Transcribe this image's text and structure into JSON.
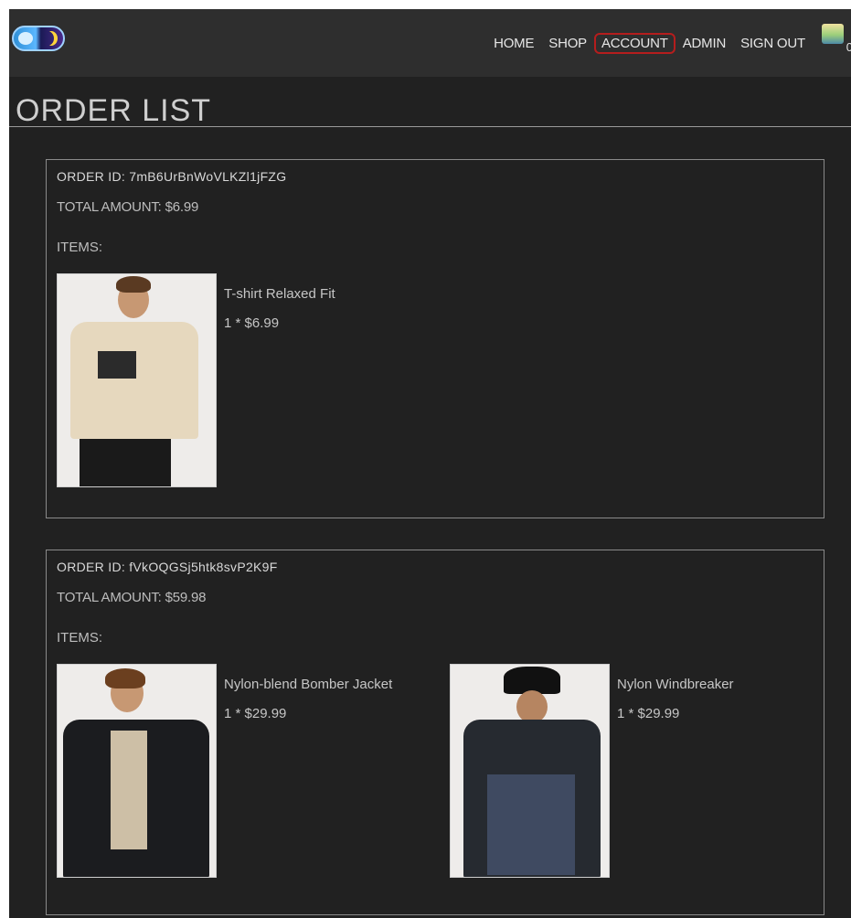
{
  "nav": {
    "items": [
      "HOME",
      "SHOP",
      "ACCOUNT",
      "ADMIN",
      "SIGN OUT"
    ],
    "active": "ACCOUNT",
    "cart_count": "0"
  },
  "page": {
    "title": "ORDER LIST"
  },
  "orders": [
    {
      "id_line": "ORDER ID: 7mB6UrBnWoVLKZl1jFZG",
      "total_line": "TOTAL AMOUNT: $6.99",
      "items_label": "ITEMS:",
      "items": [
        {
          "name": "T-shirt Relaxed Fit",
          "qty_price": "1 * $6.99"
        }
      ]
    },
    {
      "id_line": "ORDER ID: fVkOQGSj5htk8svP2K9F",
      "total_line": "TOTAL AMOUNT: $59.98",
      "items_label": "ITEMS:",
      "items": [
        {
          "name": "Nylon-blend Bomber Jacket",
          "qty_price": "1 * $29.99"
        },
        {
          "name": "Nylon Windbreaker",
          "qty_price": "1 * $29.99"
        }
      ]
    }
  ],
  "colors": {
    "background": "#212121",
    "header": "#2e2e2e",
    "text": "#cfcfcf",
    "active_outline": "#b51d1d",
    "card_border": "#8a8a8a"
  }
}
